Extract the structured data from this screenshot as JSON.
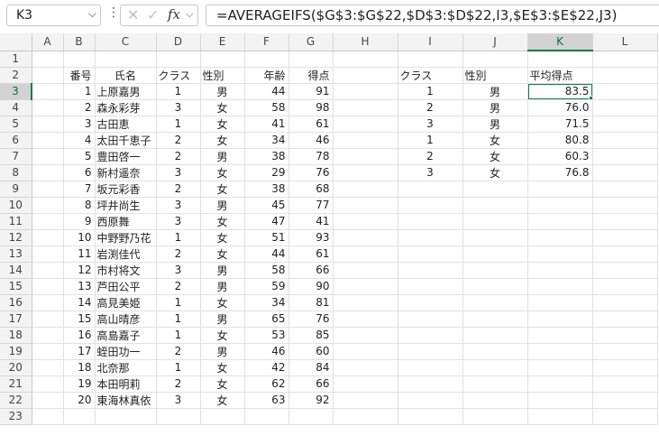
{
  "formula_bar": {
    "name_box": "K3",
    "name_box_dropdown_icon": "chevron-down",
    "more_icon": "vertical-dots",
    "cancel_icon": "cross",
    "enter_icon": "checkmark",
    "fx_label": "fx",
    "fx_dropdown_icon": "chevron-down",
    "formula": "=AVERAGEIFS($G$3:$G$22,$D$3:$D$22,I3,$E$3:$E$22,J3)"
  },
  "grid": {
    "active_cell": "K3",
    "columns": [
      "A",
      "B",
      "C",
      "D",
      "E",
      "F",
      "G",
      "H",
      "I",
      "J",
      "K",
      "L"
    ],
    "rows": [
      "1",
      "2",
      "3",
      "4",
      "5",
      "6",
      "7",
      "8",
      "9",
      "10",
      "11",
      "12",
      "13",
      "14",
      "15",
      "16",
      "17",
      "18",
      "19",
      "20",
      "21",
      "22",
      "23"
    ],
    "headers": {
      "B": "番号",
      "C": "氏名",
      "D": "クラス",
      "E": "性別",
      "F": "年齢",
      "G": "得点",
      "I": "クラス",
      "J": "性別",
      "K": "平均得点"
    },
    "students": [
      [
        "1",
        "上原嘉男",
        "1",
        "男",
        "44",
        "91"
      ],
      [
        "2",
        "森永彩芽",
        "3",
        "女",
        "58",
        "98"
      ],
      [
        "3",
        "古田恵",
        "1",
        "女",
        "41",
        "61"
      ],
      [
        "4",
        "太田千恵子",
        "2",
        "女",
        "34",
        "46"
      ],
      [
        "5",
        "豊田啓一",
        "2",
        "男",
        "38",
        "78"
      ],
      [
        "6",
        "新村遥奈",
        "3",
        "女",
        "29",
        "76"
      ],
      [
        "7",
        "坂元彩香",
        "2",
        "女",
        "38",
        "68"
      ],
      [
        "8",
        "坪井尚生",
        "3",
        "男",
        "45",
        "77"
      ],
      [
        "9",
        "西原舞",
        "3",
        "女",
        "47",
        "41"
      ],
      [
        "10",
        "中野野乃花",
        "1",
        "女",
        "51",
        "93"
      ],
      [
        "11",
        "岩渕佳代",
        "2",
        "女",
        "44",
        "61"
      ],
      [
        "12",
        "市村将文",
        "3",
        "男",
        "58",
        "66"
      ],
      [
        "13",
        "芦田公平",
        "2",
        "男",
        "59",
        "90"
      ],
      [
        "14",
        "高見美姫",
        "1",
        "女",
        "34",
        "81"
      ],
      [
        "15",
        "高山晴彦",
        "1",
        "男",
        "65",
        "76"
      ],
      [
        "16",
        "高島嘉子",
        "1",
        "女",
        "53",
        "85"
      ],
      [
        "17",
        "蛭田功一",
        "2",
        "男",
        "46",
        "60"
      ],
      [
        "18",
        "北奈那",
        "1",
        "女",
        "42",
        "84"
      ],
      [
        "19",
        "本田明莉",
        "2",
        "女",
        "62",
        "66"
      ],
      [
        "20",
        "東海林真依",
        "3",
        "女",
        "63",
        "92"
      ]
    ],
    "summary": [
      [
        "1",
        "男",
        "83.5"
      ],
      [
        "2",
        "男",
        "76.0"
      ],
      [
        "3",
        "男",
        "71.5"
      ],
      [
        "1",
        "女",
        "80.8"
      ],
      [
        "2",
        "女",
        "60.3"
      ],
      [
        "3",
        "女",
        "76.8"
      ]
    ]
  }
}
